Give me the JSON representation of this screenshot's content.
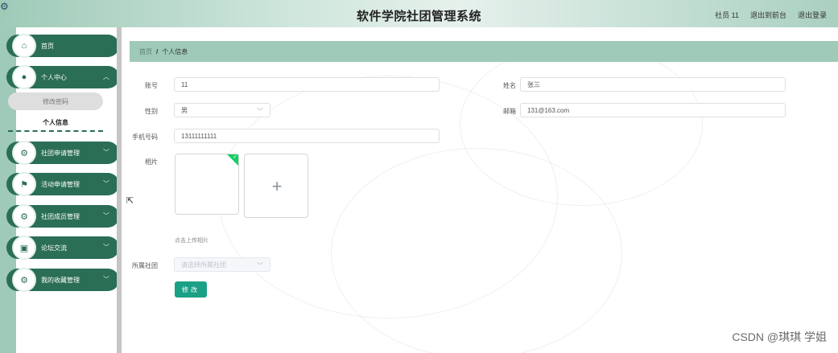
{
  "header": {
    "title": "软件学院社团管理系统",
    "user_label": "社员 11",
    "back_to_front": "退出到前台",
    "logout": "退出登录"
  },
  "sidebar": {
    "items": [
      {
        "label": "首页",
        "icon": "home-icon"
      },
      {
        "label": "个人中心",
        "icon": "user-icon",
        "expanded": true
      },
      {
        "label": "社团申请管理",
        "icon": "gear-icon"
      },
      {
        "label": "活动申请管理",
        "icon": "flag-icon"
      },
      {
        "label": "社团成员管理",
        "icon": "gear-icon"
      },
      {
        "label": "论坛交流",
        "icon": "chat-icon"
      },
      {
        "label": "我的收藏管理",
        "icon": "gear-icon"
      }
    ],
    "submenu": {
      "change_password": "修改密码",
      "personal_info": "个人信息"
    }
  },
  "breadcrumb": {
    "home": "首页",
    "separator": "/",
    "current": "个人信息"
  },
  "form": {
    "account_label": "账号",
    "account_value": "11",
    "name_label": "姓名",
    "name_value": "张三",
    "gender_label": "性别",
    "gender_value": "男",
    "email_label": "邮箱",
    "email_value": "131@163.com",
    "phone_label": "手机号码",
    "phone_value": "13111111111",
    "photo_label": "相片",
    "upload_plus": "+",
    "upload_hint": "点击上传相片",
    "club_label": "所属社团",
    "club_placeholder": "请选择所属社团",
    "submit_label": "修改"
  },
  "watermark": "CSDN @琪琪 学姐",
  "colors": {
    "accent": "#2a6e55",
    "breadcrumb_bg": "#9fc9b9",
    "button": "#1aa085"
  }
}
